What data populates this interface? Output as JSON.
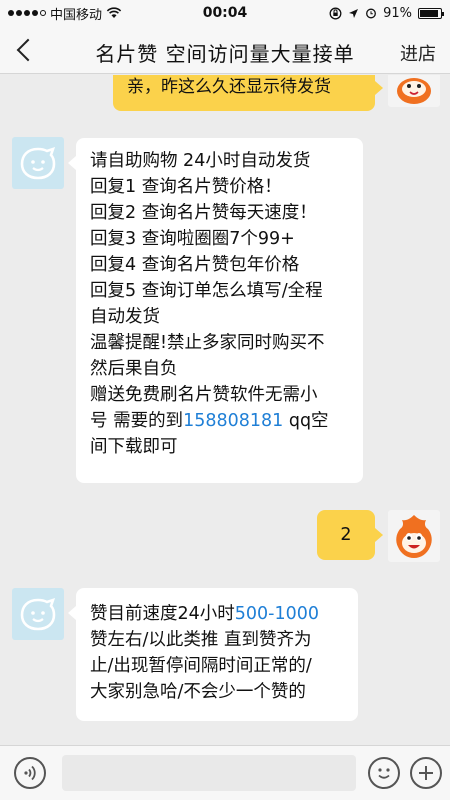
{
  "status_bar": {
    "carrier": "中国移动",
    "time": "00:04",
    "battery": "91%",
    "battery_level": 0.91
  },
  "nav": {
    "title": "名片赞 空间访问量大量接单",
    "right_label": "进店"
  },
  "messages": [
    {
      "side": "right",
      "text": "亲，昨这么久还显示待发货"
    },
    {
      "side": "left",
      "lines": [
        "请自助购物  24小时自动发货",
        "回复1 查询名片赞价格！",
        "回复2 查询名片赞每天速度！",
        "回复3 查询啦圈圈7个99+",
        "回复4 查询名片赞包年价格",
        "回复5 查询订单怎么填写/全程",
        "自动发货",
        "温馨提醒!禁止多家同时购买不",
        "然后果自负",
        "赠送免费刷名片赞软件无需小",
        "号 需要的到",
        "158808181",
        " qq空",
        "间下载即可"
      ]
    },
    {
      "side": "right",
      "text": "2"
    },
    {
      "side": "left",
      "lines": [
        " 赞目前速度24小时",
        "500-1000",
        "赞左右/以此类推 直到赞齐为",
        "止/出现暂停间隔时间正常的/",
        "大家别急哈/不会少一个赞的"
      ]
    }
  ],
  "icons": {
    "back": "chevron-left-icon",
    "wifi": "wifi-icon",
    "voice": "voice-icon",
    "emoji": "emoji-icon",
    "plus": "plus-icon"
  },
  "colors": {
    "bubble_right": "#fbd24b",
    "bubble_left": "#ffffff",
    "link": "#1f7fd6",
    "background": "#ececec"
  }
}
